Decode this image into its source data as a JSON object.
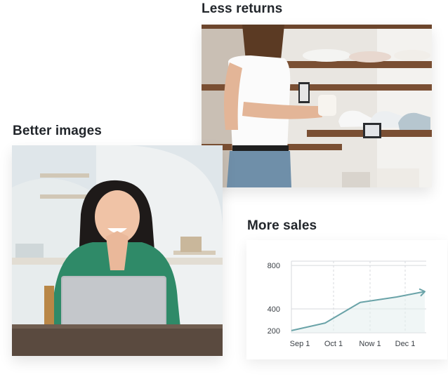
{
  "headings": {
    "less_returns": "Less returns",
    "better_images": "Better images",
    "more_sales": "More sales"
  },
  "colors": {
    "line": "#6aa3a8",
    "area": "#e3eeef",
    "grid": "#d7dadd"
  },
  "chart_data": {
    "type": "line",
    "title": "",
    "xlabel": "",
    "ylabel": "",
    "categories": [
      "Sep 1",
      "Oct 1",
      "Now 1",
      "Dec 1"
    ],
    "y_ticks": [
      200,
      400,
      800
    ],
    "series": [
      {
        "values": [
          200,
          270,
          460,
          510,
          560
        ]
      }
    ],
    "grid": true
  }
}
